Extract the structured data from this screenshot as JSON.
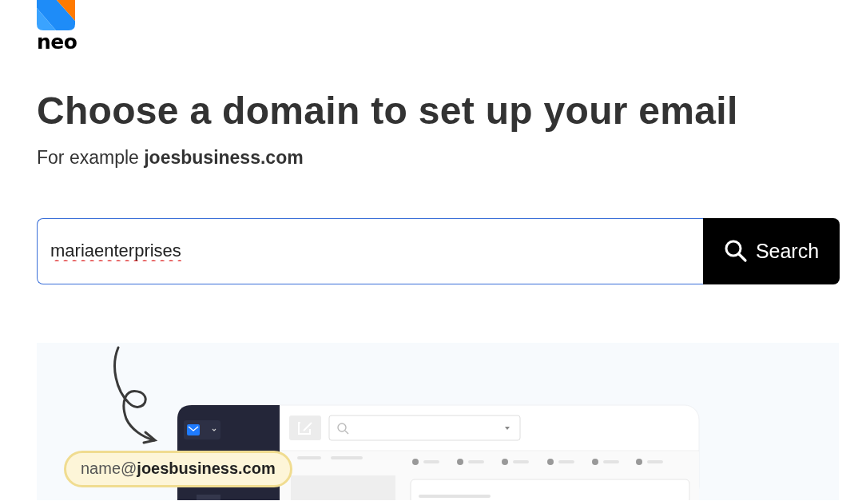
{
  "logo": {
    "text": "neo"
  },
  "heading": "Choose a domain to set up your email",
  "subtitle": "For example **joesbusiness.com**",
  "search": {
    "value": "mariaenterprises",
    "button": "Search"
  },
  "illustration": {
    "email_pill": "name@**joesbusiness.com**"
  }
}
